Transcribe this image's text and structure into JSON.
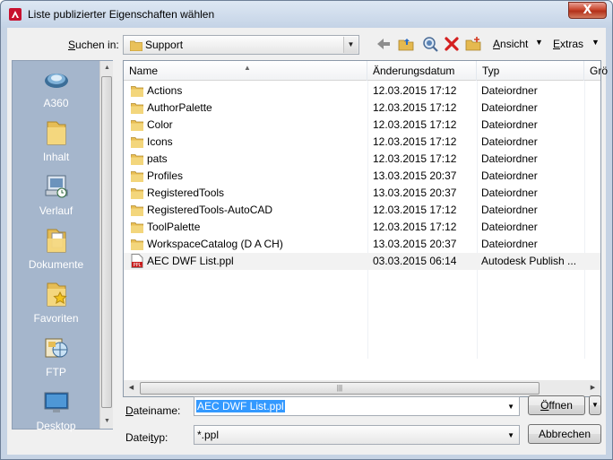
{
  "window": {
    "title": "Liste publizierter Eigenschaften wählen",
    "close_label": "X"
  },
  "toolbar": {
    "lookin_label": "Suchen in:",
    "lookin_value": "Support",
    "view_label": "Ansicht",
    "tools_label": "Extras"
  },
  "places": [
    {
      "label": "A360",
      "icon": "a360-icon"
    },
    {
      "label": "Inhalt",
      "icon": "folder-icon"
    },
    {
      "label": "Verlauf",
      "icon": "history-icon"
    },
    {
      "label": "Dokumente",
      "icon": "documents-icon"
    },
    {
      "label": "Favoriten",
      "icon": "favorites-icon"
    },
    {
      "label": "FTP",
      "icon": "ftp-icon"
    },
    {
      "label": "Desktop",
      "icon": "desktop-icon"
    }
  ],
  "filelist": {
    "columns": [
      "Name",
      "Änderungsdatum",
      "Typ",
      "Grö"
    ],
    "rows": [
      {
        "name": "Actions",
        "date": "12.03.2015 17:12",
        "type": "Dateiordner",
        "kind": "folder"
      },
      {
        "name": "AuthorPalette",
        "date": "12.03.2015 17:12",
        "type": "Dateiordner",
        "kind": "folder"
      },
      {
        "name": "Color",
        "date": "12.03.2015 17:12",
        "type": "Dateiordner",
        "kind": "folder"
      },
      {
        "name": "Icons",
        "date": "12.03.2015 17:12",
        "type": "Dateiordner",
        "kind": "folder"
      },
      {
        "name": "pats",
        "date": "12.03.2015 17:12",
        "type": "Dateiordner",
        "kind": "folder"
      },
      {
        "name": "Profiles",
        "date": "13.03.2015 20:37",
        "type": "Dateiordner",
        "kind": "folder"
      },
      {
        "name": "RegisteredTools",
        "date": "13.03.2015 20:37",
        "type": "Dateiordner",
        "kind": "folder"
      },
      {
        "name": "RegisteredTools-AutoCAD",
        "date": "12.03.2015 17:12",
        "type": "Dateiordner",
        "kind": "folder"
      },
      {
        "name": "ToolPalette",
        "date": "12.03.2015 17:12",
        "type": "Dateiordner",
        "kind": "folder"
      },
      {
        "name": "WorkspaceCatalog (D A CH)",
        "date": "13.03.2015 20:37",
        "type": "Dateiordner",
        "kind": "folder"
      },
      {
        "name": "AEC DWF List.ppl",
        "date": "03.03.2015 06:14",
        "type": "Autodesk Publish ...",
        "kind": "ppl"
      }
    ],
    "ppl_icon_text": "PPL"
  },
  "form": {
    "filename_label": "Dateiname:",
    "filename_value": "AEC DWF List.ppl",
    "filetype_label": "Dateityp:",
    "filetype_value": "*.ppl",
    "open_label": "Öffnen",
    "cancel_label": "Abbrechen"
  }
}
